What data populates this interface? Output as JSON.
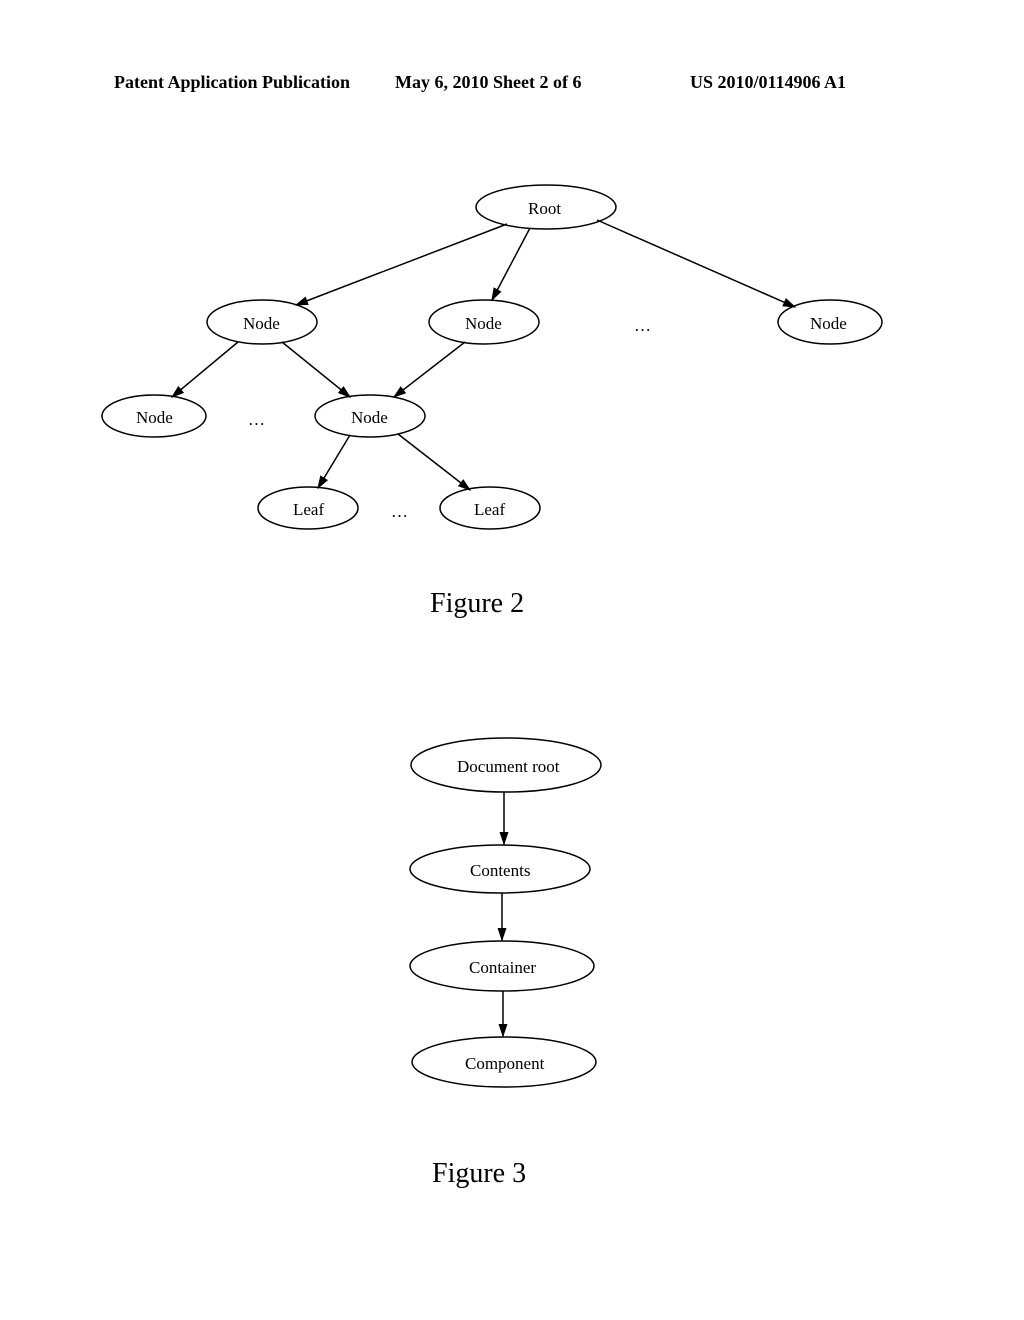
{
  "header": {
    "left": "Patent Application Publication",
    "center": "May 6, 2010   Sheet 2 of 6",
    "right": "US 2010/0114906 A1"
  },
  "figure2": {
    "title": "Figure 2",
    "nodes": {
      "root": "Root",
      "level1_node": "Node",
      "level2_node": "Node",
      "leaf": "Leaf"
    },
    "ellipsis": "…"
  },
  "figure3": {
    "title": "Figure 3",
    "nodes": {
      "docroot": "Document root",
      "contents": "Contents",
      "container": "Container",
      "component": "Component"
    }
  }
}
